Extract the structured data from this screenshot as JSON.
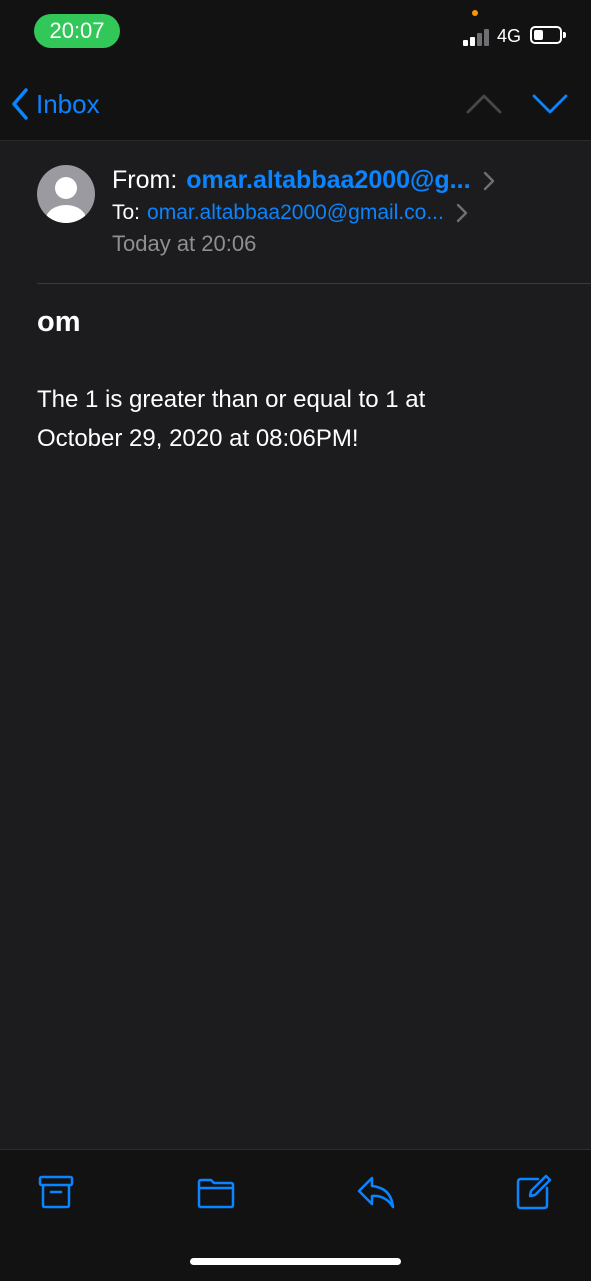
{
  "status_bar": {
    "time": "20:07",
    "network": "4G",
    "time_pill_color": "#32c759",
    "recording_dot_color": "#ff9500"
  },
  "nav": {
    "back_label": "Inbox",
    "back_icon": "chevron-left-icon",
    "prev_icon": "chevron-up-icon",
    "next_icon": "chevron-down-icon"
  },
  "message": {
    "from_label": "From:",
    "from_address": "omar.altabbaa2000@g...",
    "to_label": "To:",
    "to_address": "omar.altabbaa2000@gmail.co...",
    "date": "Today at 20:06",
    "subject": "om",
    "body_line1": "The 1 is greater than or equal to 1 at",
    "body_line2": "October 29, 2020 at 08:06PM!"
  },
  "toolbar": {
    "items": [
      "archive-icon",
      "folder-icon",
      "reply-icon",
      "compose-icon"
    ]
  },
  "colors": {
    "accent": "#0a84ff",
    "background": "#1c1c1e",
    "secondary_text": "#8e8e93"
  }
}
